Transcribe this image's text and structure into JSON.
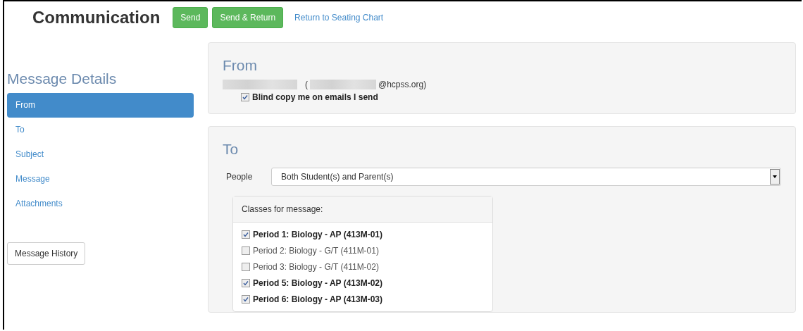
{
  "header": {
    "title": "Communication",
    "buttons": [
      "Send",
      "Send & Return"
    ],
    "link": "Return to Seating Chart"
  },
  "sidebar": {
    "heading": "Message Details",
    "items": [
      {
        "label": "From",
        "selected": true
      },
      {
        "label": "To",
        "selected": false
      },
      {
        "label": "Subject",
        "selected": false
      },
      {
        "label": "Message",
        "selected": false
      },
      {
        "label": "Attachments",
        "selected": false
      }
    ],
    "history_button": "Message History"
  },
  "from": {
    "heading": "From",
    "open_paren": "(",
    "email_domain": "@hcpss.org)",
    "bcc": {
      "label": "Blind copy me on emails I send",
      "checked": true
    }
  },
  "to": {
    "heading": "To",
    "people_label": "People",
    "people_value": "Both Student(s) and Parent(s)",
    "classes": {
      "heading": "Classes for message:",
      "items": [
        {
          "label": "Period 1: Biology - AP (413M-01)",
          "checked": true
        },
        {
          "label": "Period 2: Biology - G/T (411M-01)",
          "checked": false
        },
        {
          "label": "Period 3: Biology - G/T (411M-02)",
          "checked": false
        },
        {
          "label": "Period 5: Biology - AP (413M-02)",
          "checked": true
        },
        {
          "label": "Period 6: Biology - AP (413M-03)",
          "checked": true
        }
      ]
    }
  }
}
